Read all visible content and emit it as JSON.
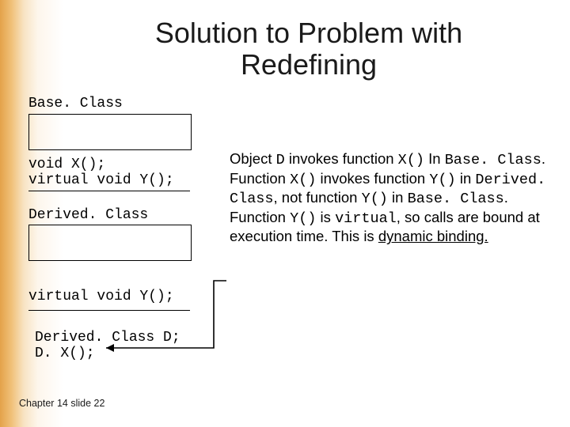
{
  "title": "Solution to Problem with Redefining",
  "base": {
    "label": "Base. Class",
    "decl1": "void X();",
    "decl2": "virtual void Y();"
  },
  "derived": {
    "label": "Derived. Class",
    "decl1": "virtual void Y();"
  },
  "usage": {
    "line1": "Derived. Class D;",
    "line2": "D. X();"
  },
  "explanation": {
    "pieces": [
      {
        "t": "Object ",
        "c": "sans"
      },
      {
        "t": "D",
        "c": "code"
      },
      {
        "t": " invokes function ",
        "c": "sans"
      },
      {
        "t": "X()",
        "c": "code"
      },
      {
        "t": " In ",
        "c": "sans"
      },
      {
        "t": "Base. Class",
        "c": "code"
      },
      {
        "t": ".  Function ",
        "c": "sans"
      },
      {
        "t": "X()",
        "c": "code"
      },
      {
        "t": " invokes function ",
        "c": "sans"
      },
      {
        "t": "Y()",
        "c": "code"
      },
      {
        "t": " in ",
        "c": "sans"
      },
      {
        "t": "Derived. Class",
        "c": "code"
      },
      {
        "t": ", not function ",
        "c": "sans"
      },
      {
        "t": "Y()",
        "c": "code"
      },
      {
        "t": " in ",
        "c": "sans"
      },
      {
        "t": "Base. Class",
        "c": "code"
      },
      {
        "t": ".  Function ",
        "c": "sans"
      },
      {
        "t": "Y()",
        "c": "code"
      },
      {
        "t": " is ",
        "c": "sans"
      },
      {
        "t": "virtual",
        "c": "code"
      },
      {
        "t": ", so calls are bound at execution time. This is ",
        "c": "sans"
      },
      {
        "t": "dynamic binding.",
        "c": "sans ul"
      }
    ]
  },
  "footer": "Chapter 14 slide 22"
}
